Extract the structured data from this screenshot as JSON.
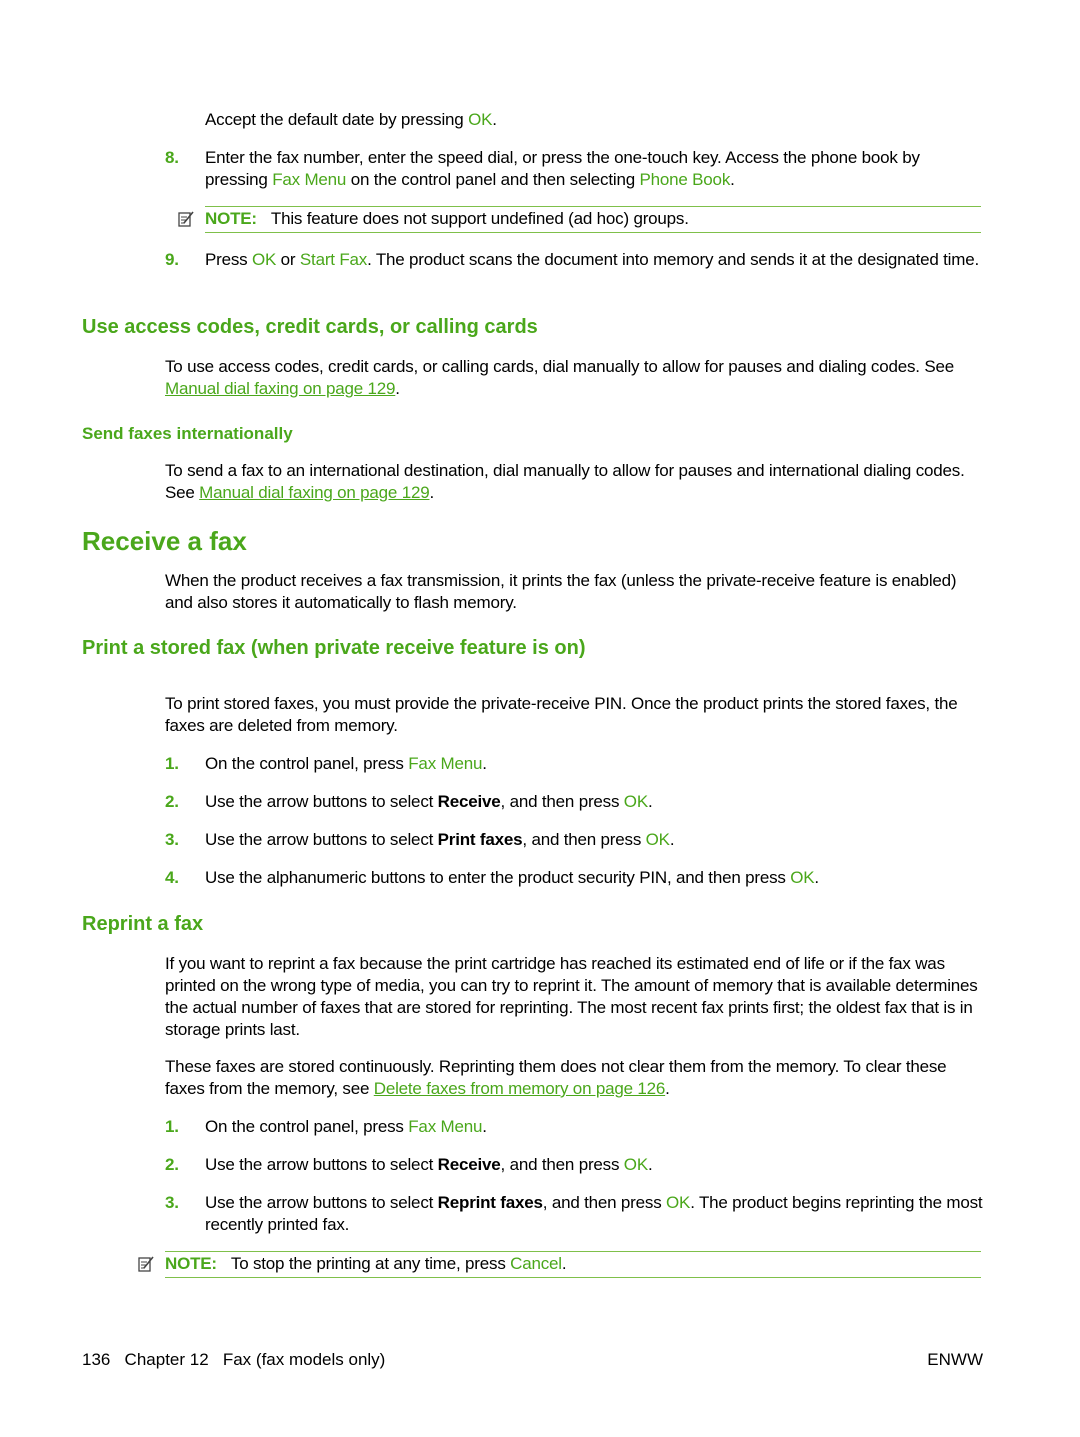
{
  "page": {
    "intro_line": {
      "before": "Accept the default date by pressing ",
      "key": "OK",
      "after": "."
    },
    "step8": {
      "number": "8.",
      "p1": "Enter the fax number, enter the speed dial, or press the one-touch key. Access the phone book by pressing ",
      "key1": "Fax Menu",
      "p2": " on the control panel and then selecting ",
      "key2": "Phone Book",
      "p3": "."
    },
    "note1": {
      "label": "NOTE:",
      "text": "This feature does not support undefined (ad hoc) groups."
    },
    "step9": {
      "number": "9.",
      "p1": "Press ",
      "key1": "OK",
      "p2": " or ",
      "key2": "Start Fax",
      "p3": ". The product scans the document into memory and sends it at the designated time."
    },
    "access_codes": {
      "heading": "Use access codes, credit cards, or calling cards",
      "text": "To use access codes, credit cards, or calling cards, dial manually to allow for pauses and dialing codes. See ",
      "link": "Manual dial faxing on page 129",
      "after": "."
    },
    "international": {
      "heading": "Send faxes internationally",
      "text": "To send a fax to an international destination, dial manually to allow for pauses and international dialing codes. See ",
      "link": "Manual dial faxing on page 129",
      "after": "."
    },
    "receive": {
      "heading": "Receive a fax",
      "text": "When the product receives a fax transmission, it prints the fax (unless the private-receive feature is enabled) and also stores it automatically to flash memory."
    },
    "stored": {
      "heading": "Print a stored fax (when private receive feature is on)",
      "text": "To print stored faxes, you must provide the private-receive PIN. Once the product prints the stored faxes, the faxes are deleted from memory.",
      "steps": [
        {
          "number": "1.",
          "a": "On the control panel, press ",
          "key": "Fax Menu",
          "b": "",
          "bold": "",
          "c": ".",
          "ok": ""
        },
        {
          "number": "2.",
          "a": "Use the arrow buttons to select ",
          "bold": "Receive",
          "b": ", and then press ",
          "key": "OK",
          "c": "."
        },
        {
          "number": "3.",
          "a": "Use the arrow buttons to select ",
          "bold": "Print faxes",
          "b": ", and then press ",
          "key": "OK",
          "c": "."
        },
        {
          "number": "4.",
          "a": "Use the alphanumeric buttons to enter the product security PIN, and then press ",
          "bold": "",
          "b": "",
          "key": "OK",
          "c": "."
        }
      ]
    },
    "reprint": {
      "heading": "Reprint a fax",
      "text1": "If you want to reprint a fax because the print cartridge has reached its estimated end of life or if the fax was printed on the wrong type of media, you can try to reprint it. The amount of memory that is available determines the actual number of faxes that are stored for reprinting. The most recent fax prints first; the oldest fax that is in storage prints last.",
      "text2": "These faxes are stored continuously. Reprinting them does not clear them from the memory. To clear these faxes from the memory, see ",
      "link": "Delete faxes from memory on page 126",
      "after": ".",
      "steps": [
        {
          "number": "1.",
          "a": "On the control panel, press ",
          "key": "Fax Menu",
          "c": "."
        },
        {
          "number": "2.",
          "a": "Use the arrow buttons to select ",
          "bold": "Receive",
          "b": ", and then press ",
          "key": "OK",
          "c": "."
        },
        {
          "number": "3.",
          "a": "Use the arrow buttons to select ",
          "bold": "Reprint faxes",
          "b": ", and then press ",
          "key": "OK",
          "c": ". The product begins reprinting the most recently printed fax."
        }
      ]
    },
    "note2": {
      "label": "NOTE:",
      "text_before": "To stop the printing at any time, press ",
      "key": "Cancel",
      "text_after": "."
    },
    "footer": {
      "page_number": "136",
      "chapter": "Chapter 12",
      "chapter_title": "Fax (fax models only)",
      "right": "ENWW"
    }
  }
}
